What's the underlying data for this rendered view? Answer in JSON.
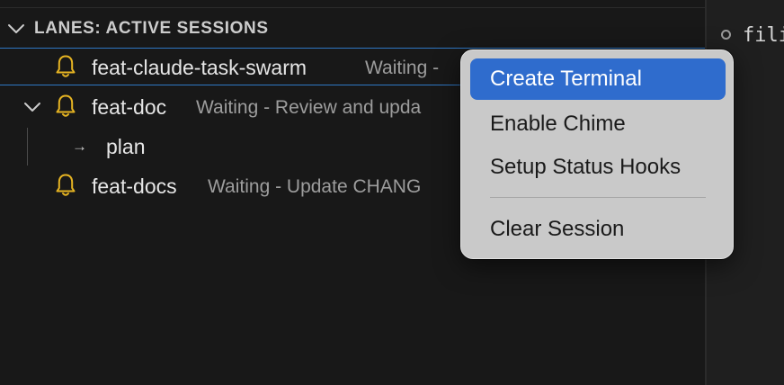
{
  "right_pane": {
    "text": "fili"
  },
  "section": {
    "title": "LANES: ACTIVE SESSIONS"
  },
  "sessions": [
    {
      "label": "feat-claude-task-swarm",
      "description": "Waiting - "
    },
    {
      "label": "feat-doc",
      "description": "Waiting - Review and upda",
      "children": [
        {
          "arrow": "→",
          "label": "plan"
        }
      ]
    },
    {
      "label": "feat-docs",
      "description": "Waiting - Update CHANG"
    }
  ],
  "context_menu": {
    "items": [
      {
        "label": "Create Terminal",
        "highlighted": true
      },
      {
        "label": "Enable Chime"
      },
      {
        "label": "Setup Status Hooks"
      },
      {
        "label": "Clear Session"
      }
    ]
  },
  "colors": {
    "bell": "#e6b422",
    "focus_border": "#2f77c4",
    "menu_highlight": "#2f6ccd"
  }
}
